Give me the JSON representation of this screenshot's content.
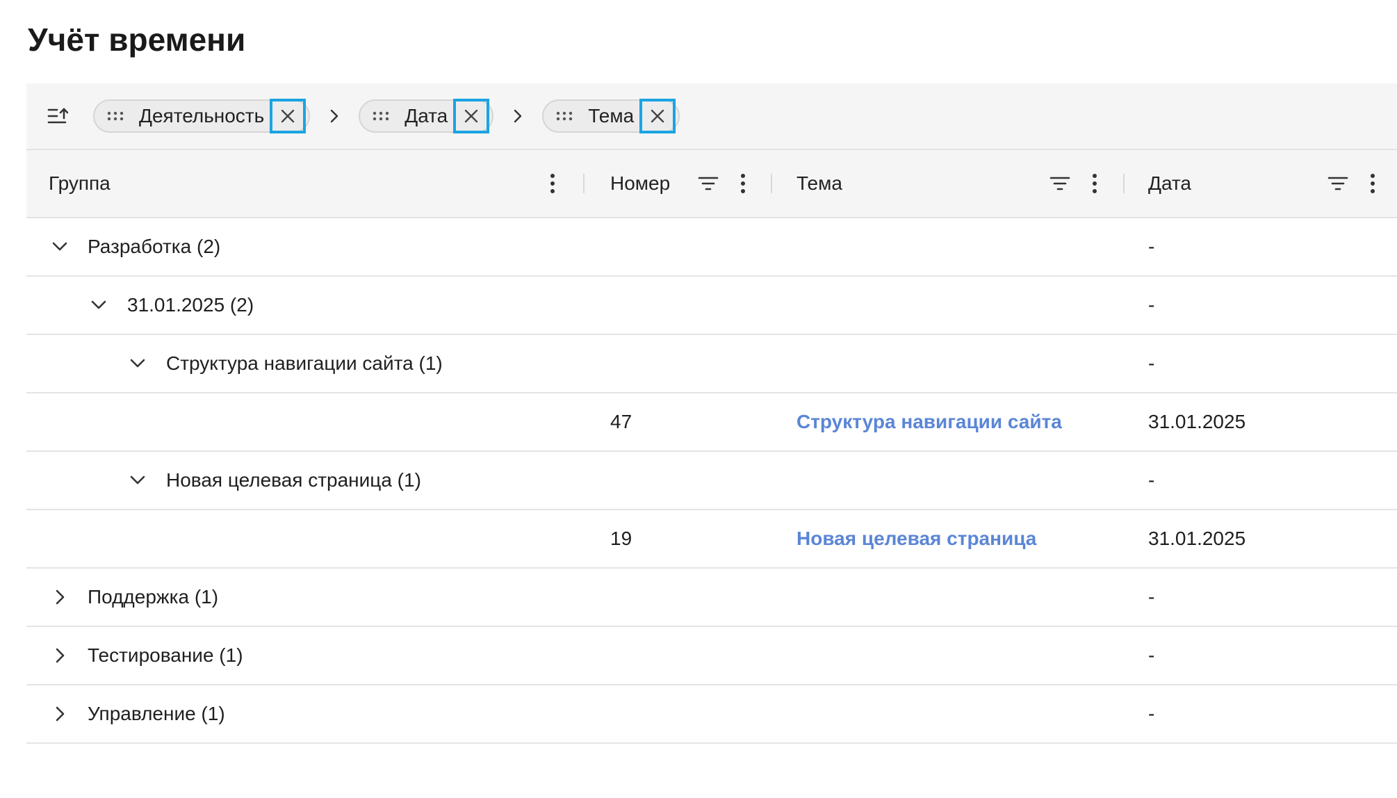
{
  "page": {
    "title": "Учёт времени"
  },
  "group_bar": {
    "chips": [
      {
        "label": "Деятельность"
      },
      {
        "label": "Дата"
      },
      {
        "label": "Тема"
      }
    ]
  },
  "columns": [
    {
      "label": "Группа"
    },
    {
      "label": "Номер"
    },
    {
      "label": "Тема"
    },
    {
      "label": "Дата"
    }
  ],
  "rows": [
    {
      "label": "Разработка (2)",
      "date": "-"
    },
    {
      "label": "31.01.2025 (2)",
      "date": "-"
    },
    {
      "label": "Структура навигации сайта (1)",
      "date": "-"
    },
    {
      "number": "47",
      "topic": "Структура навигации сайта",
      "date": "31.01.2025"
    },
    {
      "label": "Новая целевая страница (1)",
      "date": "-"
    },
    {
      "number": "19",
      "topic": "Новая целевая страница",
      "date": "31.01.2025"
    },
    {
      "label": "Поддержка (1)",
      "date": "-"
    },
    {
      "label": "Тестирование (1)",
      "date": "-"
    },
    {
      "label": "Управление (1)",
      "date": "-"
    }
  ],
  "colors": {
    "accent": "#1ba4e2",
    "link": "#5b86d6",
    "header_bg": "#f5f5f5"
  }
}
